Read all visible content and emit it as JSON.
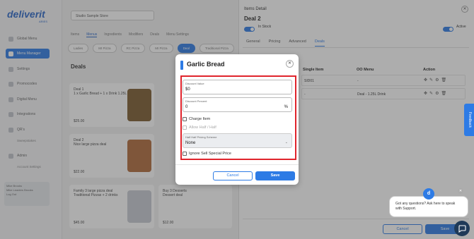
{
  "background": {
    "logo": "deliverit",
    "logo_sub": "ARIES",
    "store_select": "Studio Sample Store",
    "sidebar_items": [
      "Global Menu",
      "Menu Manager",
      "Settings",
      "Promocodes",
      "Digital Menu",
      "Integrations",
      "QR's",
      "Sweepstakes",
      "Admin",
      "Account Settings"
    ],
    "sidebar_bottom": [
      "Mike Brooks",
      "Mike Leaders Brooks",
      "Log Out"
    ],
    "main_tabs": [
      "Items",
      "Menus",
      "Ingredients",
      "Modifiers",
      "Deals",
      "Menu Settings"
    ],
    "category_tabs": [
      "Ladies",
      "MI Pizza",
      "RC Pizza",
      "MI Pizza",
      "Deal",
      "Traditional Pizza"
    ],
    "deals_heading": "Deals",
    "deal_cards": [
      {
        "title": "Deal 1",
        "desc": "1 x Garlic Bread + 1 x Drink 1.25L",
        "price": "$25.00"
      },
      {
        "title": "Deal 2",
        "desc": "Nice large pizza deal",
        "price": "$22.00"
      },
      {
        "title": "Family 3 large pizza deal",
        "desc": "Traditional Pizzas + 2 drinks",
        "price": "$45.00"
      },
      {
        "title": "Buy 3 Desserts",
        "desc": "Dessert deal",
        "price": "$12.00"
      }
    ]
  },
  "drawer": {
    "title": "Items Detail",
    "deal_name": "Deal 2",
    "in_stock_label": "In Stock",
    "active_label": "Active",
    "tabs": [
      "General",
      "Pricing",
      "Advanced",
      "Deals"
    ],
    "active_tab": "Deals",
    "table_headers": {
      "single_item": "Single Item",
      "oo_menu": "OO Menu",
      "action": "Action"
    },
    "rows": [
      {
        "single_item": "SID01",
        "oo_menu": "-"
      },
      {
        "single_item": "-",
        "oo_menu": "Deal - 1.25L Drink"
      }
    ],
    "cancel_label": "Cancel",
    "save_label": "Save"
  },
  "feedback_label": "Feedback",
  "chat": {
    "avatar": "d",
    "message": "Got any questions? Ask here to speak with Support."
  },
  "modal": {
    "title": "Garlic Bread",
    "discount_value": {
      "label": "Discount Value",
      "value": "$0"
    },
    "discount_percent": {
      "label": "Discount Percent",
      "value": "0",
      "suffix": "%"
    },
    "charge_item_label": "Charge Item",
    "allow_half_label": "Allow Half / Half",
    "half_half_scheme": {
      "label": "Half Half Pricing Scheme",
      "value": "None"
    },
    "ignore_sell_label": "Ignore Sell Special Price",
    "cancel_label": "Cancel",
    "save_label": "Save"
  },
  "colors": {
    "accent": "#2d7be5",
    "highlight": "#e0242c"
  }
}
